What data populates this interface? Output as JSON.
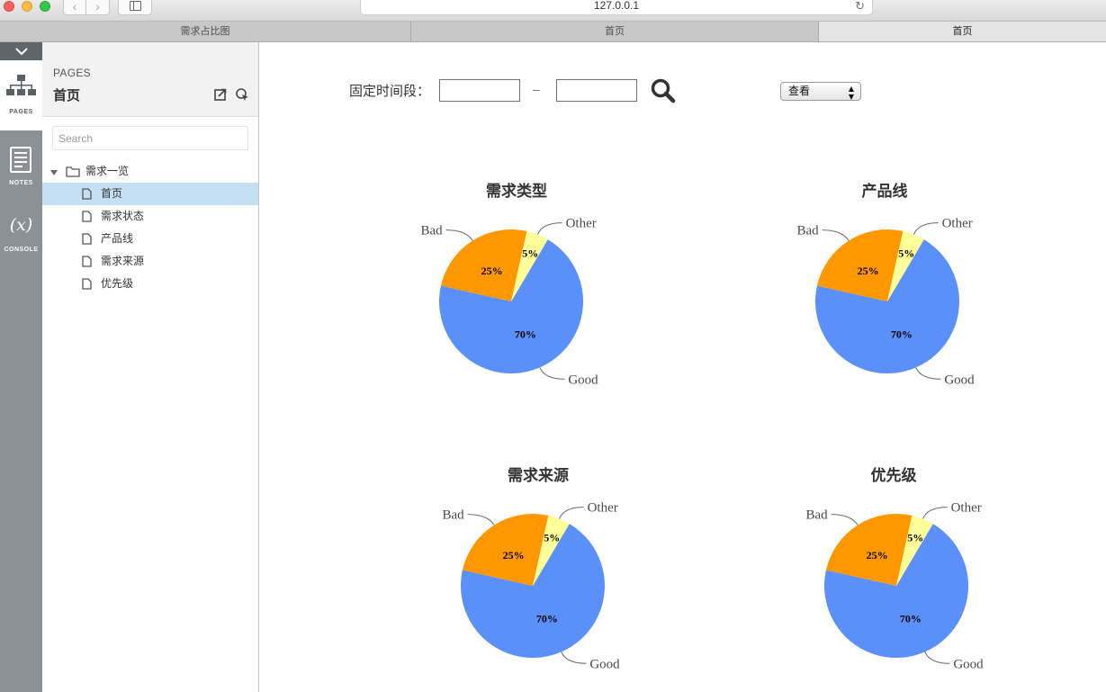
{
  "browser": {
    "url": "127.0.0.1",
    "tabs": [
      "需求占比图",
      "首页",
      "首页"
    ]
  },
  "rail": {
    "pages_label": "PAGES",
    "notes_label": "NOTES",
    "console_label": "CONSOLE"
  },
  "panel": {
    "kicker": "PAGES",
    "title": "首页",
    "search_placeholder": "Search",
    "folder": "需求一览",
    "pages": [
      "首页",
      "需求状态",
      "产品线",
      "需求来源",
      "优先级"
    ],
    "selected": "首页"
  },
  "filter": {
    "label": "固定时间段：",
    "dash": "–",
    "start_value": "",
    "end_value": "",
    "view_select": "查看"
  },
  "colors": {
    "good": "#5b8ff9",
    "bad": "#ff9800",
    "other": "#ffff99",
    "selected_row": "#c5dff4"
  },
  "chart_data": [
    {
      "type": "pie",
      "title": "需求类型",
      "slices": [
        {
          "label": "Good",
          "value": 70,
          "text": "70%"
        },
        {
          "label": "Bad",
          "value": 25,
          "text": "25%"
        },
        {
          "label": "Other",
          "value": 5,
          "text": "5%"
        }
      ]
    },
    {
      "type": "pie",
      "title": "产品线",
      "slices": [
        {
          "label": "Good",
          "value": 70,
          "text": "70%"
        },
        {
          "label": "Bad",
          "value": 25,
          "text": "25%"
        },
        {
          "label": "Other",
          "value": 5,
          "text": "5%"
        }
      ]
    },
    {
      "type": "pie",
      "title": "需求来源",
      "slices": [
        {
          "label": "Good",
          "value": 70,
          "text": "70%"
        },
        {
          "label": "Bad",
          "value": 25,
          "text": "25%"
        },
        {
          "label": "Other",
          "value": 5,
          "text": "5%"
        }
      ]
    },
    {
      "type": "pie",
      "title": "优先级",
      "slices": [
        {
          "label": "Good",
          "value": 70,
          "text": "70%"
        },
        {
          "label": "Bad",
          "value": 25,
          "text": "25%"
        },
        {
          "label": "Other",
          "value": 5,
          "text": "5%"
        }
      ]
    }
  ]
}
